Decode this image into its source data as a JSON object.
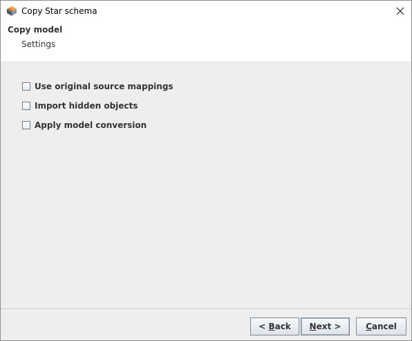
{
  "window": {
    "title": "Copy Star schema"
  },
  "header": {
    "title": "Copy model",
    "subtitle": "Settings"
  },
  "options": [
    {
      "label": "Use original source mappings",
      "checked": false
    },
    {
      "label": "Import hidden objects",
      "checked": false
    },
    {
      "label": "Apply model conversion",
      "checked": false
    }
  ],
  "buttons": {
    "back": {
      "prefix": "< ",
      "mnemonic": "B",
      "rest": "ack"
    },
    "next": {
      "mnemonic": "N",
      "rest": "ext >"
    },
    "cancel": {
      "mnemonic": "C",
      "rest": "ancel"
    }
  }
}
